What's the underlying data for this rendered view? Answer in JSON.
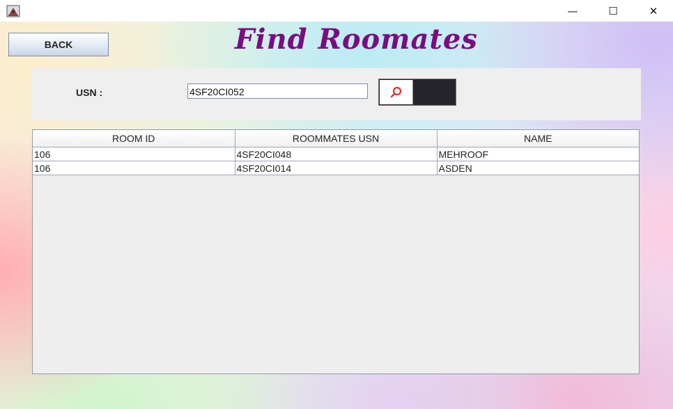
{
  "window": {
    "minimize_glyph": "—",
    "maximize_glyph": "☐",
    "close_glyph": "✕",
    "app_icon": "java-app-icon"
  },
  "page": {
    "title": "Find Roomates",
    "back_label": "BACK",
    "title_color": "#7b0c80"
  },
  "search": {
    "label": "USN :",
    "value": "4SF20CI052",
    "button_icon": "search-icon",
    "button_icon_color": "#e03030"
  },
  "table": {
    "columns": [
      "ROOM ID",
      "ROOMMATES USN",
      "NAME"
    ],
    "rows": [
      [
        "106",
        "4SF20CI048",
        "MEHROOF"
      ],
      [
        "106",
        "4SF20CI014",
        "ASDEN"
      ]
    ]
  }
}
